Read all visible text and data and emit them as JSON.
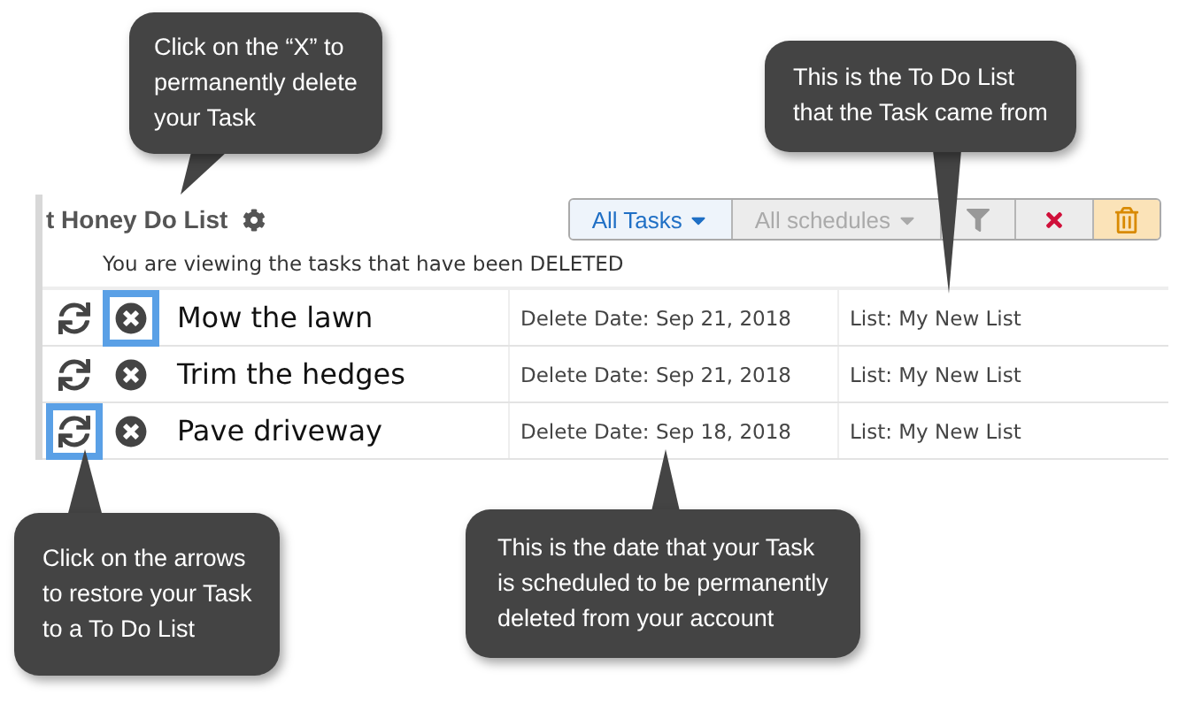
{
  "panel": {
    "title": "t Honey Do List",
    "notice": "You are viewing the tasks that have been DELETED"
  },
  "toolbar": [
    {
      "kind": "dropdown",
      "label": "All Tasks",
      "selected": true
    },
    {
      "kind": "dropdown",
      "label": "All schedules",
      "selected": false
    },
    {
      "kind": "filter",
      "selected": false
    },
    {
      "kind": "clear",
      "selected": false
    },
    {
      "kind": "trash",
      "selected": true
    }
  ],
  "tasks": [
    {
      "name": "Mow the lawn",
      "delete_date": "Delete Date: Sep 21, 2018",
      "list": "List: My New List",
      "delete_highlighted": true,
      "restore_highlighted": false
    },
    {
      "name": "Trim the hedges",
      "delete_date": "Delete Date: Sep 21, 2018",
      "list": "List: My New List",
      "delete_highlighted": false,
      "restore_highlighted": false
    },
    {
      "name": "Pave driveway",
      "delete_date": "Delete Date: Sep 18, 2018",
      "list": "List: My New List",
      "delete_highlighted": false,
      "restore_highlighted": true
    }
  ],
  "callouts": [
    {
      "lines": [
        "Click on the “X” to",
        "permanently delete",
        "your Task"
      ]
    },
    {
      "lines": [
        "This is the To Do List",
        "that the Task came from"
      ]
    },
    {
      "lines": [
        "Click on the arrows",
        "to restore your Task",
        "to a To Do List"
      ]
    },
    {
      "lines": [
        "This is the date that your Task",
        "is scheduled to be permanently",
        "deleted from your account"
      ]
    }
  ]
}
